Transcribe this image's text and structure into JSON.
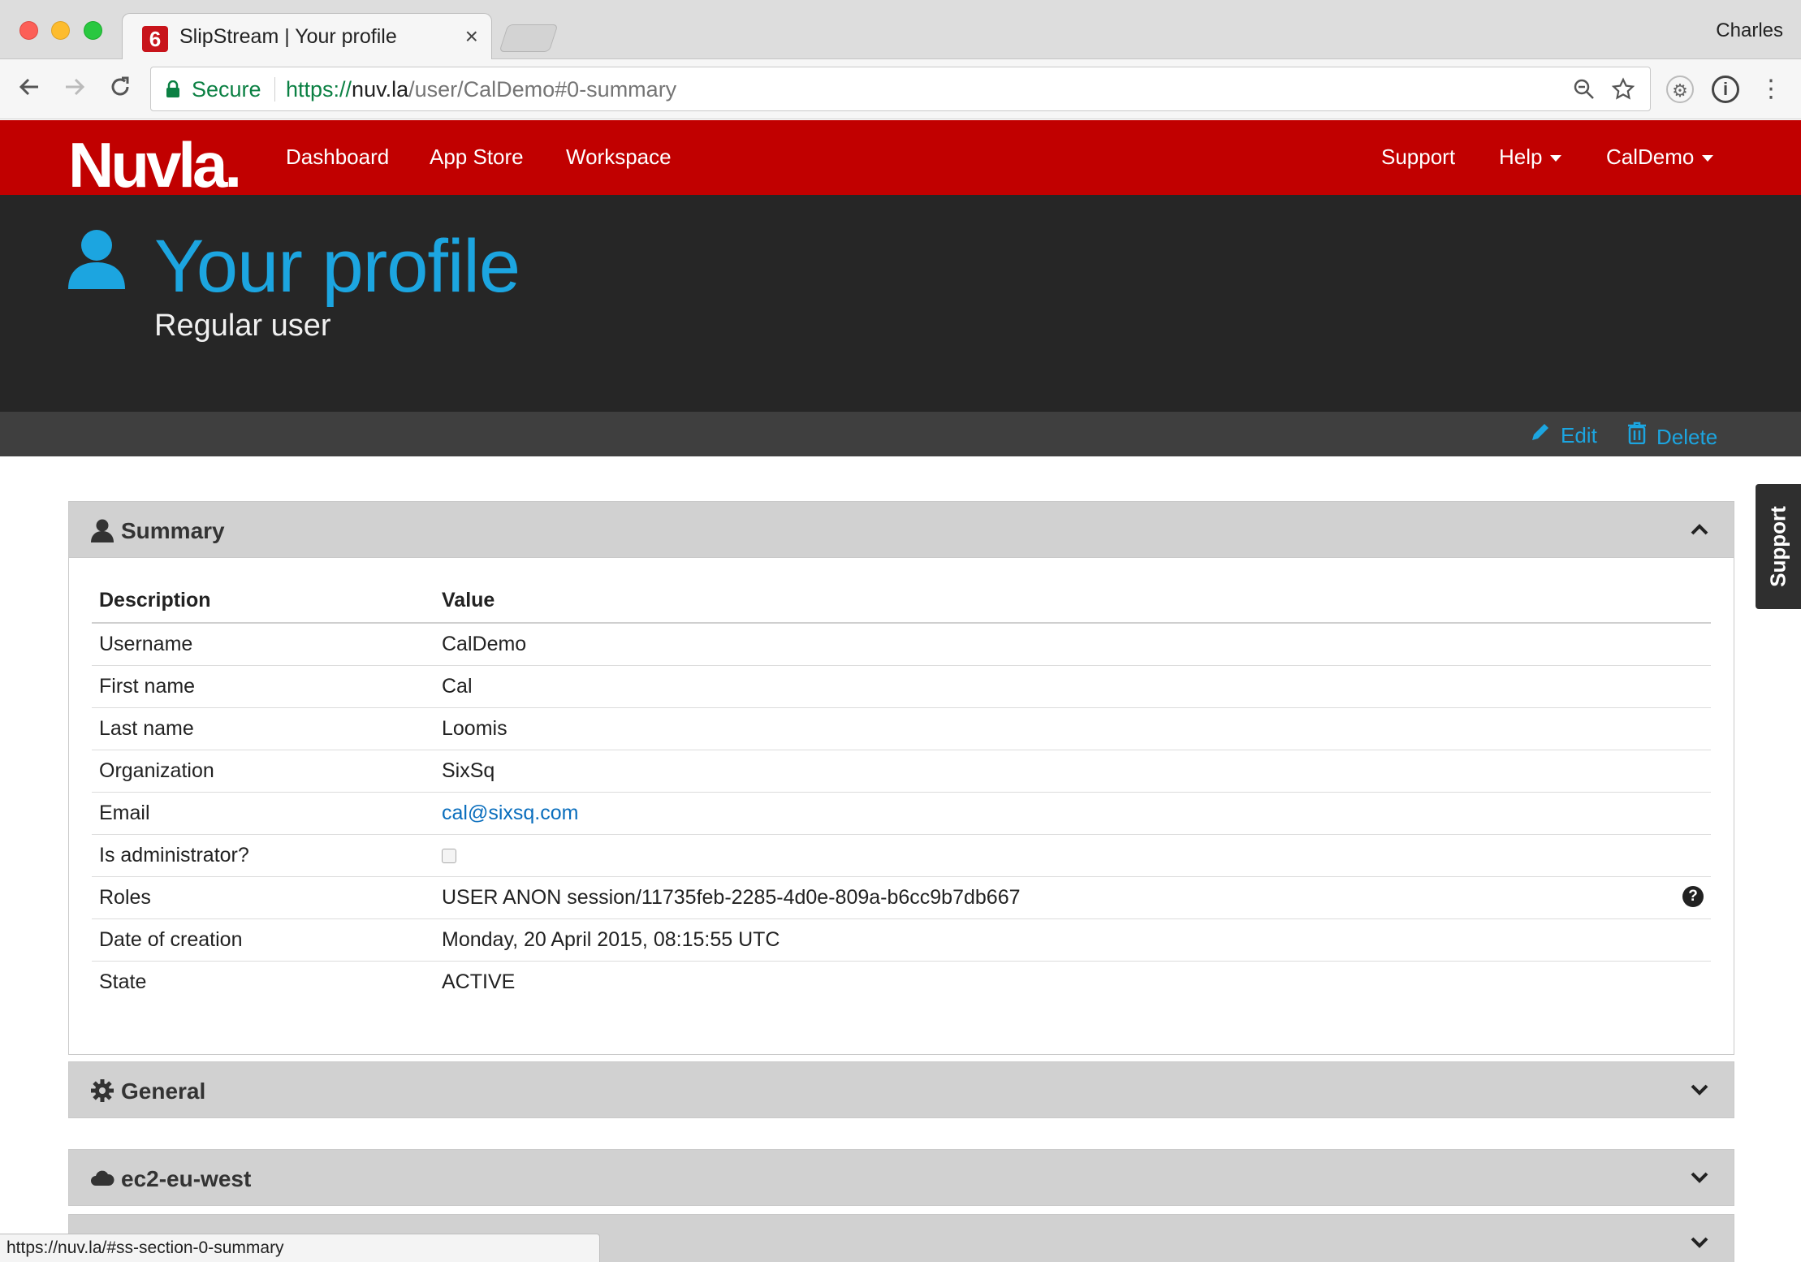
{
  "browser": {
    "tab_title": "SlipStream | Your profile",
    "tab_close": "×",
    "profile_name": "Charles",
    "omnibox": {
      "secure_label": "Secure",
      "url_scheme": "https://",
      "url_host": "nuv.la",
      "url_path": "/user/CalDemo#0-summary"
    },
    "status_url": "https://nuv.la/#ss-section-0-summary"
  },
  "site": {
    "logo": "Nuvla.",
    "nav_left": [
      "Dashboard",
      "App Store",
      "Workspace"
    ],
    "nav_right": {
      "support": "Support",
      "help": "Help",
      "user": "CalDemo"
    }
  },
  "hero": {
    "title": "Your profile",
    "subtitle": "Regular user"
  },
  "actions": {
    "edit": "Edit",
    "delete": "Delete"
  },
  "support_tab": "Support",
  "sections": {
    "summary": {
      "title": "Summary",
      "table": {
        "headers": [
          "Description",
          "Value"
        ],
        "rows": [
          {
            "label": "Username",
            "value": "CalDemo"
          },
          {
            "label": "First name",
            "value": "Cal"
          },
          {
            "label": "Last name",
            "value": "Loomis"
          },
          {
            "label": "Organization",
            "value": "SixSq"
          },
          {
            "label": "Email",
            "value": "cal@sixsq.com"
          },
          {
            "label": "Is administrator?",
            "value": ""
          },
          {
            "label": "Roles",
            "value": "USER ANON session/11735feb-2285-4d0e-809a-b6cc9b7db667"
          },
          {
            "label": "Date of creation",
            "value": "Monday, 20 April 2015, 08:15:55 UTC"
          },
          {
            "label": "State",
            "value": "ACTIVE"
          }
        ]
      }
    },
    "general": {
      "title": "General"
    },
    "ec2": {
      "title": "ec2-eu-west"
    }
  },
  "colors": {
    "brand_red": "#c10000",
    "hero_bg": "#262626",
    "accent_blue": "#1ca5e0",
    "link_blue": "#0a6ebd"
  }
}
